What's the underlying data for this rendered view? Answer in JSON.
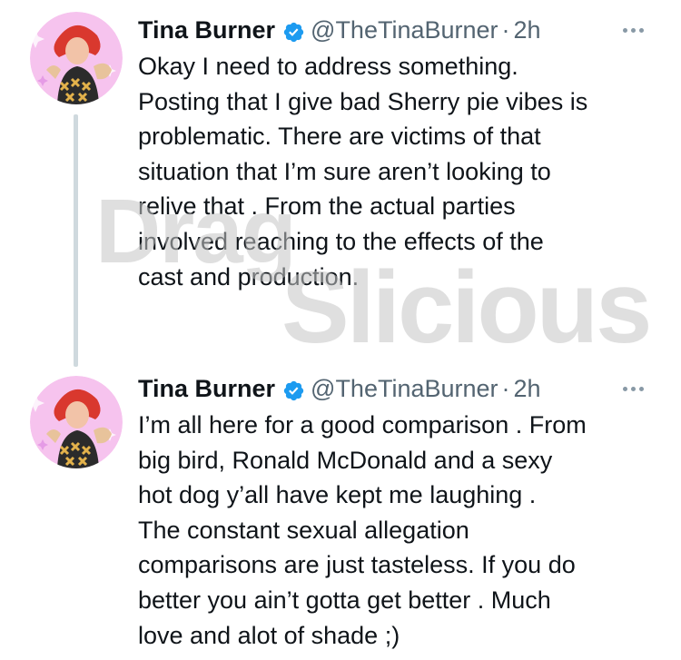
{
  "tweets": [
    {
      "author_name": "Tina Burner",
      "handle": "@TheTinaBurner",
      "separator": "·",
      "time": "2h",
      "text": "Okay I need to address something.\nPosting that I give bad Sherry pie vibes is\nproblematic. There are victims of that\nsituation that I’m sure aren’t looking to\nrelive that . From the actual parties\ninvolved reaching to the effects of the\ncast and production."
    },
    {
      "author_name": "Tina Burner",
      "handle": "@TheTinaBurner",
      "separator": "·",
      "time": "2h",
      "text": "I’m all here for a good comparison . From\nbig bird, Ronald McDonald and a sexy\nhot dog  y’all have kept me laughing .\nThe constant sexual allegation\ncomparisons are just tasteless. If you do\nbetter you ain’t gotta get better . Much\nlove and alot of shade ;)"
    }
  ],
  "watermark": {
    "line1": "Drag",
    "line2": "Slicious"
  },
  "colors": {
    "verified": "#1d9bf0",
    "secondary_text": "#536471",
    "thread_line": "#cfd9de"
  },
  "icons": {
    "verified": "verified-badge-icon",
    "more": "more-options-icon"
  }
}
